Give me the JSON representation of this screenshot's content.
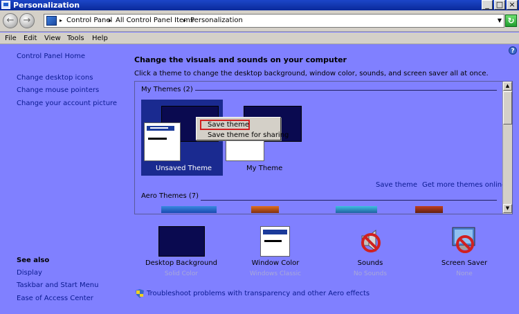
{
  "window": {
    "title": "Personalization",
    "minimize": "_",
    "maximize": "□",
    "close": "×"
  },
  "address": {
    "crumbs": [
      "Control Panel",
      "All Control Panel Items",
      "Personalization"
    ]
  },
  "menu": [
    "File",
    "Edit",
    "View",
    "Tools",
    "Help"
  ],
  "sidebar": {
    "home": "Control Panel Home",
    "links": [
      "Change desktop icons",
      "Change mouse pointers",
      "Change your account picture"
    ],
    "see_also_title": "See also",
    "see_also": [
      "Display",
      "Taskbar and Start Menu",
      "Ease of Access Center"
    ]
  },
  "main": {
    "heading": "Change the visuals and sounds on your computer",
    "subheading": "Click a theme to change the desktop background, window color, sounds, and screen saver all at once.",
    "groups": [
      {
        "label": "My Themes (2)"
      },
      {
        "label": "Aero Themes (7)"
      }
    ],
    "themes": [
      {
        "name": "Unsaved Theme",
        "selected": true
      },
      {
        "name": "My Theme",
        "selected": false
      }
    ],
    "save_theme_link": "Save theme",
    "get_more_link": "Get more themes online",
    "context_menu": [
      "Save theme",
      "Save theme for sharing"
    ],
    "bottom": [
      {
        "label": "Desktop Background",
        "sub": "Solid Color",
        "icon": "desktop-background-icon"
      },
      {
        "label": "Window Color",
        "sub": "Windows Classic",
        "icon": "window-color-icon"
      },
      {
        "label": "Sounds",
        "sub": "No Sounds",
        "icon": "sounds-icon"
      },
      {
        "label": "Screen Saver",
        "sub": "None",
        "icon": "screen-saver-icon"
      }
    ],
    "troubleshoot": "Troubleshoot problems with transparency and other Aero effects"
  },
  "colors": {
    "background": "#8080ff",
    "link": "#0a1a90",
    "selection": "#1a2a90",
    "highlight_border": "#d02020"
  }
}
